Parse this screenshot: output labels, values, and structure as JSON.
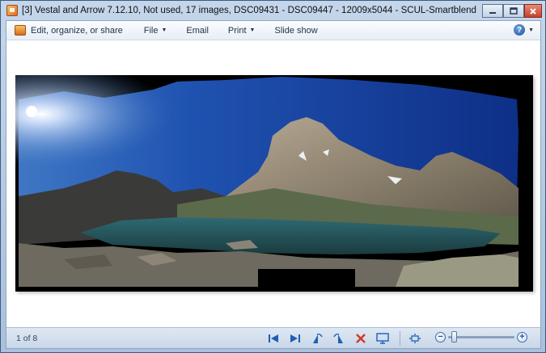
{
  "window": {
    "title": "[3] Vestal and Arrow 7.12.10, Not used, 17 images, DSC09431 - DSC09447 - 12009x5044 - SCUL-Smartblend - Windows Live Photo G...",
    "icons": {
      "app": "photo-gallery-icon",
      "minimize": "minimize-icon",
      "maximize": "maximize-icon",
      "close": "close-icon"
    }
  },
  "menu": {
    "edit_label": "Edit, organize, or share",
    "file_label": "File",
    "email_label": "Email",
    "print_label": "Print",
    "slideshow_label": "Slide show",
    "help_glyph": "?"
  },
  "status": {
    "counter": "1 of 8",
    "zoom_level": 0.05
  },
  "toolbar_icons": [
    "previous-icon",
    "next-icon",
    "rotate-left-icon",
    "rotate-right-icon",
    "delete-icon",
    "slideshow-icon",
    "actual-size-icon",
    "zoom-out-icon",
    "zoom-in-icon"
  ],
  "colors": {
    "accent": "#1e5fb4",
    "delete": "#d23a2a",
    "titlebar": "#b9cde4"
  }
}
